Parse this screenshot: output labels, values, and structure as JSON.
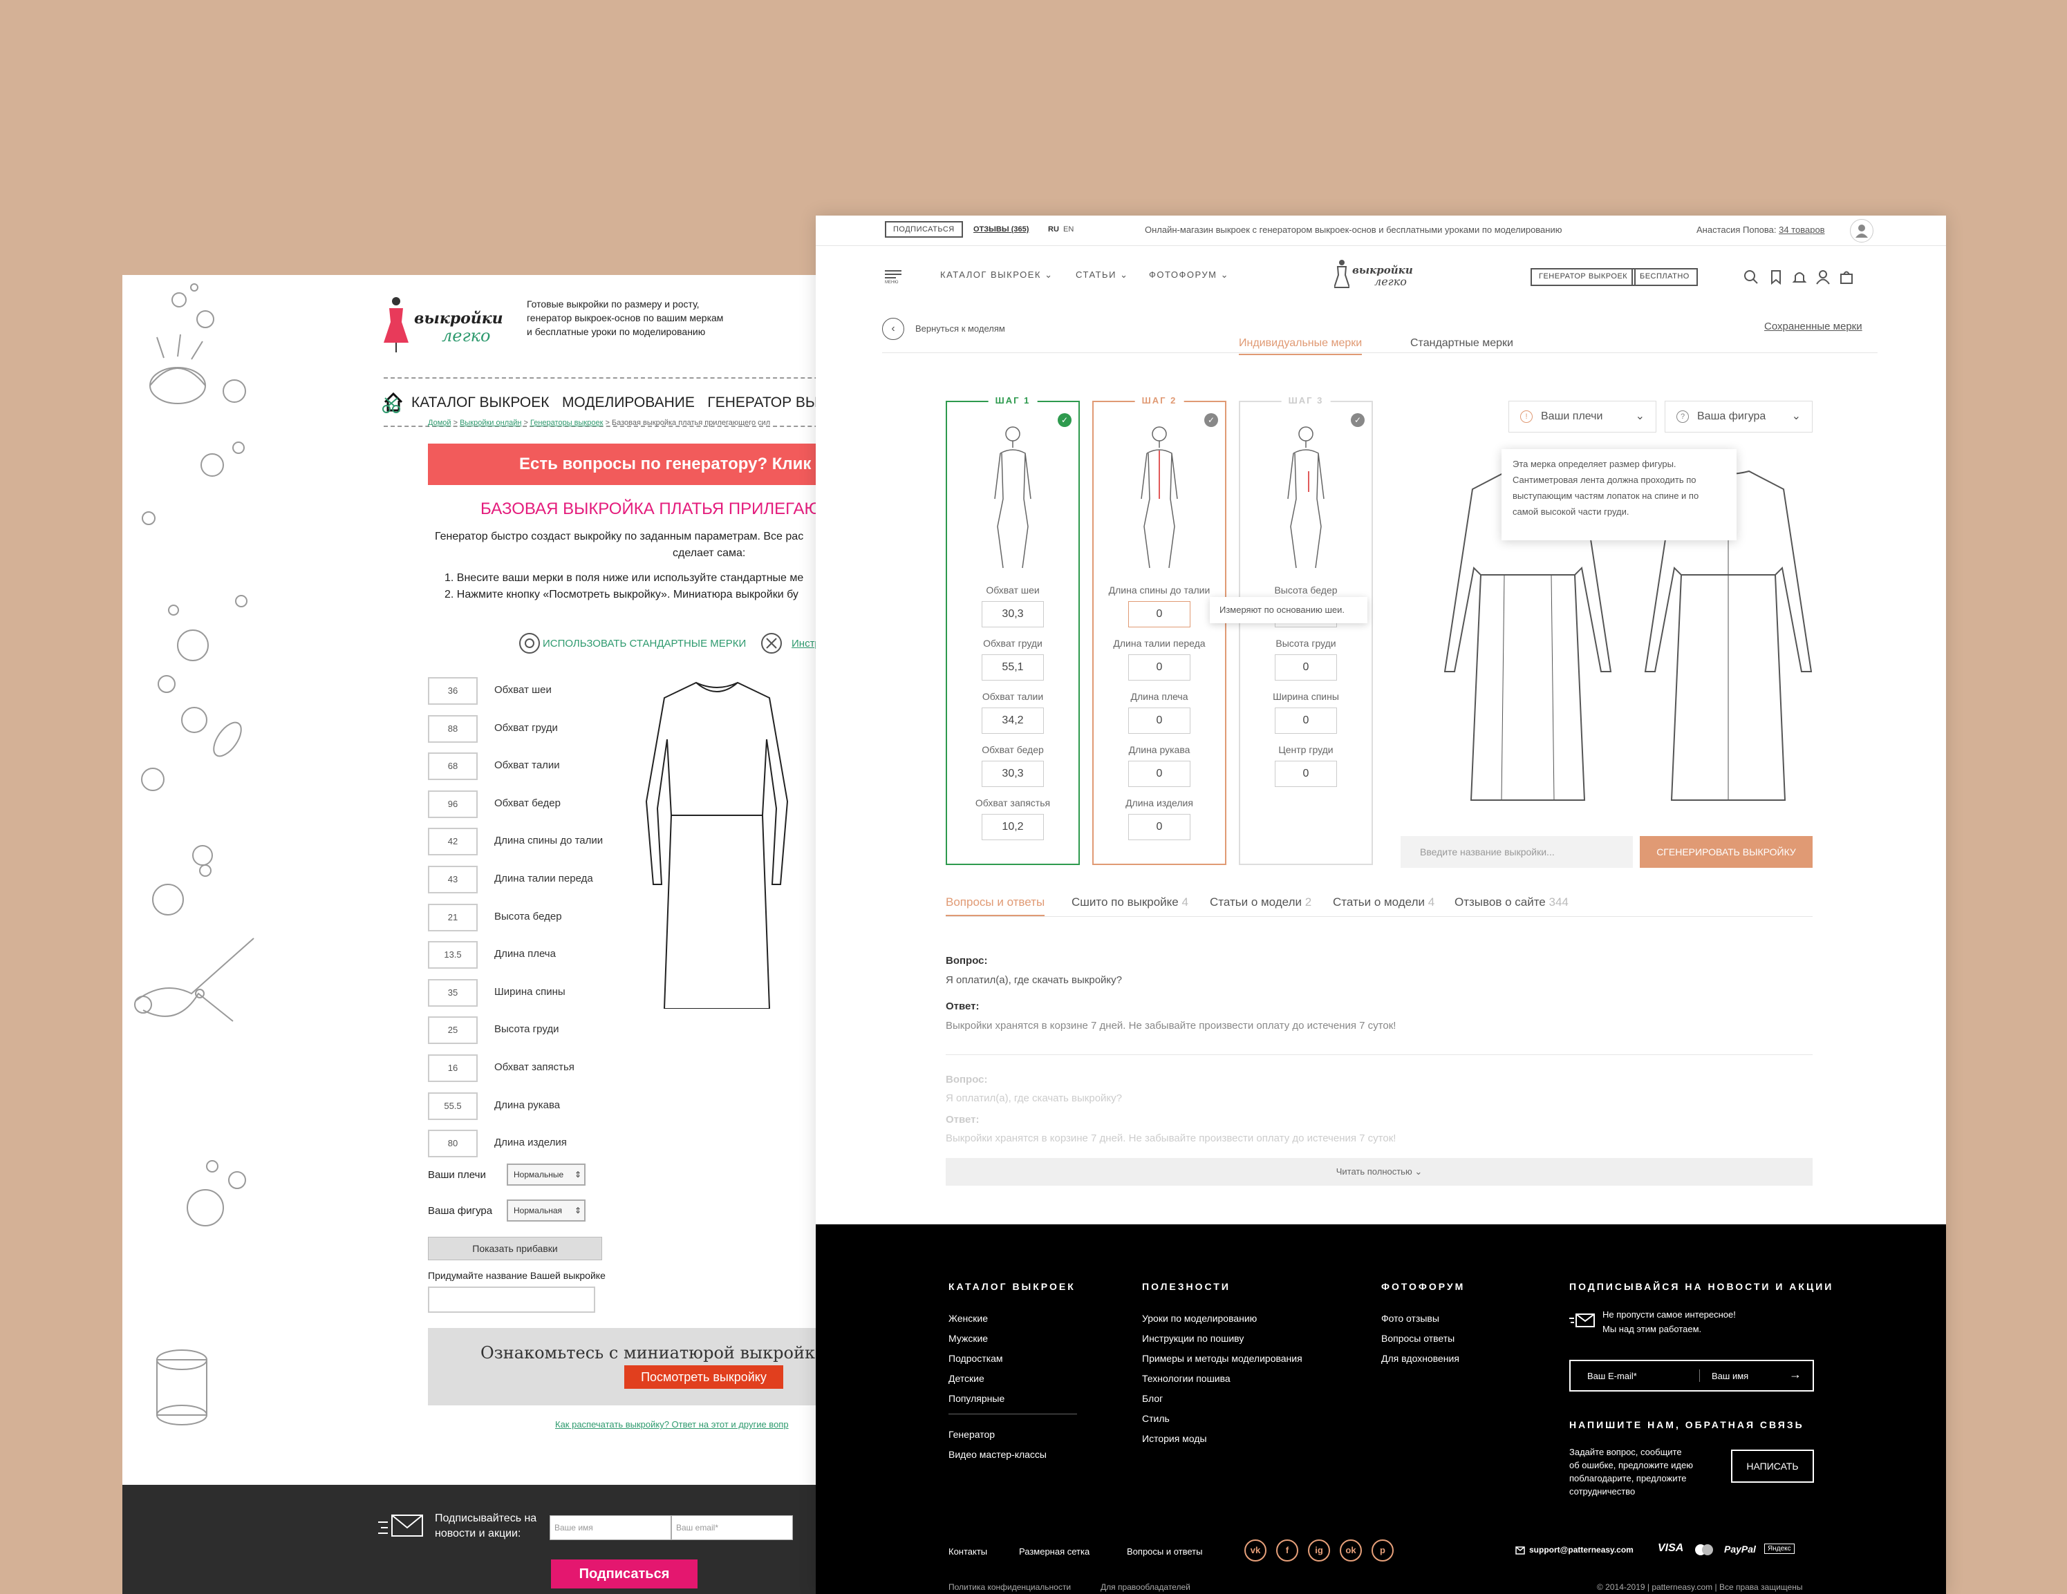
{
  "old": {
    "tagline_1": "Готовые выкройки по размеру и росту,",
    "tagline_2": "генератор выкроек-основ по вашим меркам",
    "tagline_3": "и бесплатные уроки по моделированию",
    "logo_1": "выкройки",
    "logo_2": "легко",
    "nav": [
      "КАТАЛОГ ВЫКРОЕК",
      "МОДЕЛИРОВАНИЕ",
      "ГЕНЕРАТОР ВЫКРОЕК-ОСН"
    ],
    "crumbs": [
      {
        "text": "Домой",
        "link": true
      },
      {
        "text": " > ",
        "link": false
      },
      {
        "text": "Выкройки онлайн",
        "link": true
      },
      {
        "text": " > ",
        "link": false
      },
      {
        "text": "Генераторы выкроек",
        "link": true
      },
      {
        "text": " > Базовая выкройка платья прилегающего сил",
        "link": false
      }
    ],
    "banner": "Есть вопросы по генератору? Клик",
    "heading": "БАЗОВАЯ ВЫКРОЙКА ПЛАТЬЯ ПРИЛЕГАЮЩ",
    "intro_1": "Генератор быстро создаст выкройку по заданным параметрам. Все рас",
    "intro_2": "сделает сама:",
    "step_1": "1.  Внесите ваши мерки в поля ниже или используйте стандартные ме",
    "step_2": "2.  Нажмите кнопку «Посмотреть выкройку». Миниатюра выкройки бу",
    "std_link": "ИСПОЛЬЗОВАТЬ СТАНДАРТНЫЕ МЕРКИ",
    "instr_link": "Инстр",
    "measures": [
      {
        "value": "36",
        "label": "Обхват шеи"
      },
      {
        "value": "88",
        "label": "Обхват груди"
      },
      {
        "value": "68",
        "label": "Обхват талии"
      },
      {
        "value": "96",
        "label": "Обхват бедер"
      },
      {
        "value": "42",
        "label": "Длина спины до талии"
      },
      {
        "value": "43",
        "label": "Длина талии переда"
      },
      {
        "value": "21",
        "label": "Высота бедер"
      },
      {
        "value": "13.5",
        "label": "Длина плеча"
      },
      {
        "value": "35",
        "label": "Ширина спины"
      },
      {
        "value": "25",
        "label": "Высота груди"
      },
      {
        "value": "16",
        "label": "Обхват запястья"
      },
      {
        "value": "55.5",
        "label": "Длина рукава"
      },
      {
        "value": "80",
        "label": "Длина изделия"
      }
    ],
    "shoulders_label": "Ваши плечи",
    "shoulders_value": "Нормальные",
    "figure_label": "Ваша фигура",
    "figure_value": "Нормальная",
    "show_btn": "Показать прибавки",
    "name_label": "Придумайте название Вашей выкройке",
    "preview_text": "Ознакомьтесь с миниатюрой выкройк",
    "preview_btn": "Посмотреть выкройку",
    "print_link": "Как распечатать выкройку? Ответ на этот и другие вопр",
    "sub_text_1": "Подписывайтесь на",
    "sub_text_2": "новости и акции:",
    "sub_name_ph": "Ваше имя",
    "sub_email_ph": "Ваш email*",
    "sub_btn": "Подписаться"
  },
  "new": {
    "topbar": {
      "subscribe": "ПОДПИСАТЬСЯ",
      "reviews": "ОТЗЫВЫ (365)",
      "lang_ru": "RU",
      "lang_en": "EN",
      "center": "Онлайн-магазин выкроек с генератором выкроек-основ и бесплатными уроками по моделированию",
      "user": "Анастасия Попова:",
      "cart": "34 товаров"
    },
    "header": {
      "menu": "МЕНЮ",
      "nav": [
        "КАТАЛОГ ВЫКРОЕК",
        "СТАТЬИ",
        "ФОТОФОРУМ"
      ],
      "logo_1": "выкройки",
      "logo_2": "легко",
      "gen_btn": "ГЕНЕРАТОР ВЫКРОЕК",
      "free_btn": "БЕСПЛАТНО"
    },
    "back": "Вернуться к моделям",
    "tab_individual": "Индивидуальные мерки",
    "tab_standard": "Стандартные мерки",
    "saved": "Сохраненные мерки",
    "steps": [
      {
        "tag": "ШАГ 1",
        "fields": [
          {
            "label": "Обхват шеи",
            "value": "30,3"
          },
          {
            "label": "Обхват груди",
            "value": "55,1"
          },
          {
            "label": "Обхват талии",
            "value": "34,2"
          },
          {
            "label": "Обхват бедер",
            "value": "30,3"
          },
          {
            "label": "Обхват запястья",
            "value": "10,2"
          }
        ]
      },
      {
        "tag": "ШАГ 2",
        "fields": [
          {
            "label": "Длина спины до талии",
            "value": "0"
          },
          {
            "label": "Длина талии переда",
            "value": "0"
          },
          {
            "label": "Длина плеча",
            "value": "0"
          },
          {
            "label": "Длина рукава",
            "value": "0"
          },
          {
            "label": "Длина изделия",
            "value": "0"
          }
        ]
      },
      {
        "tag": "ШАГ 3",
        "fields": [
          {
            "label": "Высота бедер",
            "value": "0"
          },
          {
            "label": "Высота груди",
            "value": "0"
          },
          {
            "label": "Ширина спины",
            "value": "0"
          },
          {
            "label": "Центр груди",
            "value": "0"
          }
        ]
      }
    ],
    "hint_small": "Измеряют по основанию шеи.",
    "shoulders_select": "Ваши плечи",
    "figure_select": "Ваша фигура",
    "tooltip": "Эта мерка определяет размер фигуры. Сантиметровая лента должна проходить по выступающим частям лопаток на спине и по самой высокой части груди.",
    "name_ph": "Введите название выкройки...",
    "generate_btn": "СГЕНЕРИРОВАТЬ ВЫКРОЙКУ",
    "qa_tabs": [
      {
        "label": "Вопросы и ответы",
        "count": ""
      },
      {
        "label": "Сшито по выкройке",
        "count": "4"
      },
      {
        "label": "Статьи о модели",
        "count": "2"
      },
      {
        "label": "Статьи о модели",
        "count": "4"
      },
      {
        "label": "Отзывов о сайте",
        "count": "344"
      }
    ],
    "q_label": "Вопрос:",
    "q_text": "Я оплатил(а), где скачать выкройку?",
    "a_label": "Ответ:",
    "a_text": "Выкройки хранятся в корзине 7 дней. Не забывайте произвести оплату до истечения 7 суток!",
    "read_more": "Читать полностью",
    "footer": {
      "col1_title": "КАТАЛОГ ВЫКРОЕК",
      "col1": [
        "Женские",
        "Мужские",
        "Подросткам",
        "Детские",
        "Популярные"
      ],
      "col1b": [
        "Генератор",
        "Видео мастер-классы"
      ],
      "col2_title": "ПОЛЕЗНОСТИ",
      "col2": [
        "Уроки по моделированию",
        "Инструкции по пошиву",
        "Примеры и методы моделирования",
        "Технологии пошива",
        "Блог",
        "Стиль",
        "История моды"
      ],
      "col3_title": "ФОТОФОРУМ",
      "col3": [
        "Фото отзывы",
        "Вопросы ответы",
        "Для вдохновения"
      ],
      "col4_title": "ПОДПИСЫВАЙСЯ НА НОВОСТИ И АКЦИИ",
      "sub_text_1": "Не пропусти самое интересное!",
      "sub_text_2": "Мы над этим работаем.",
      "email_ph": "Ваш E-mail*",
      "name_ph": "Ваш имя",
      "contact_title": "НАПИШИТЕ НАМ, ОБРАТНАЯ СВЯЗЬ",
      "contact_text": [
        "Задайте вопрос, сообщите",
        "об ошибке, предложите идею",
        "поблагодарите, предложите",
        "сотрудничество"
      ],
      "write_btn": "НАПИСАТЬ",
      "bottom_links": [
        "Контакты",
        "Размерная сетка",
        "Вопросы и ответы"
      ],
      "social": [
        "vk",
        "f",
        "ig",
        "ok",
        "p"
      ],
      "email": "support@patterneasy.com",
      "payments": [
        "VISA",
        "MC",
        "PayPal",
        "Яндекс"
      ],
      "policy": "Политика конфиденциальности",
      "rights_holders": "Для правообладателей",
      "copyright": "© 2014-2019 | patterneasy.com | Все права защищены"
    },
    "accent": "#e09a74",
    "green": "#2e9a4e"
  }
}
